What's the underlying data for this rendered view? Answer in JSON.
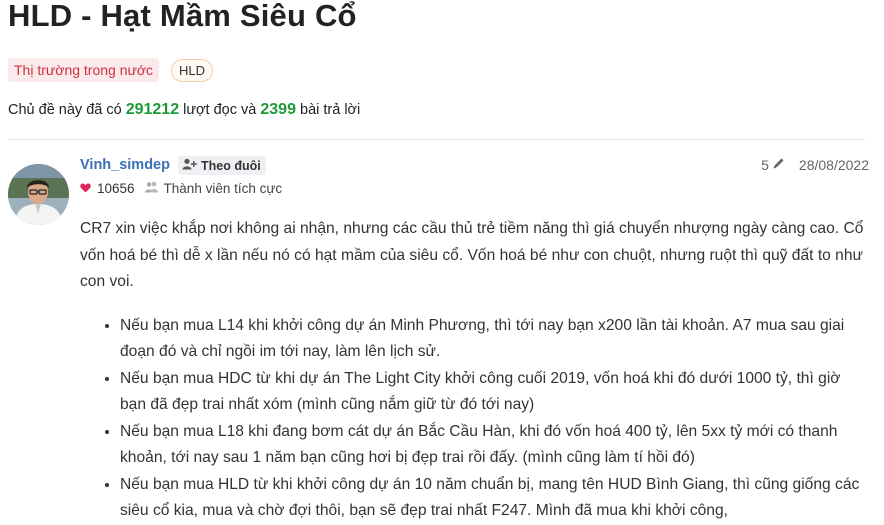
{
  "topic": {
    "title": "HLD - Hạt Mầm Siêu Cổ",
    "category_tag": "Thị trường trong nước",
    "ticker_tag": "HLD",
    "stats": {
      "prefix": "Chủ đề này đã có",
      "views": "291212",
      "mid": "lượt đọc và",
      "replies": "2399",
      "suffix": "bài trả lời"
    }
  },
  "post": {
    "author": "Vinh_simdep",
    "follow_label": "Theo đuôi",
    "edit_count": "5",
    "date": "28/08/2022",
    "reputation": "10656",
    "rank": "Thành viên tích cực",
    "paragraph": "CR7 xin việc khắp nơi không ai nhận, nhưng các cầu thủ trẻ tiềm năng thì giá chuyển nhượng ngày càng cao. Cổ vốn hoá bé thì dễ x lần nếu nó có hạt mầm của siêu cổ. Vốn hoá bé như con chuột, nhưng ruột thì quỹ đất to như con voi.",
    "bullets": [
      "Nếu bạn mua L14 khi khởi công dự án Minh Phương, thì tới nay bạn x200 lần tài khoản. A7 mua sau giai đoạn đó và chỉ ngồi im tới nay, làm lên lịch sử.",
      "Nếu bạn mua HDC từ khi dự án The Light City khởi công cuối 2019, vốn hoá khi đó dưới 1000 tỷ, thì giờ bạn đã đẹp trai nhất xóm (mình cũng nắm giữ từ đó tới nay)",
      "Nếu bạn mua L18 khi đang bơm cát dự án Bắc Cầu Hàn, khi đó vốn hoá 400 tỷ, lên 5xx tỷ mới có thanh khoản, tới nay sau 1 năm bạn cũng hơi bị đẹp trai rồi đấy. (mình cũng làm tí hồi đó)",
      "Nếu bạn mua HLD từ khi khởi công dự án 10 năm chuẩn bị, mang tên HUD Bình Giang, thì cũng giống các siêu cổ kia, mua và chờ đợi thôi, bạn sẽ đẹp trai nhất F247. Mình đã mua khi khởi công,"
    ]
  },
  "colors": {
    "title": "#222222",
    "author": "#3b6fb6",
    "stat_numbers": "#1f9a3a",
    "category_text": "#d0303c",
    "category_bg": "#fbeaec",
    "reputation_heart": "#e0245e"
  },
  "icons": [
    "follow-user-icon",
    "pencil-icon",
    "heart-icon",
    "rank-users-icon"
  ]
}
